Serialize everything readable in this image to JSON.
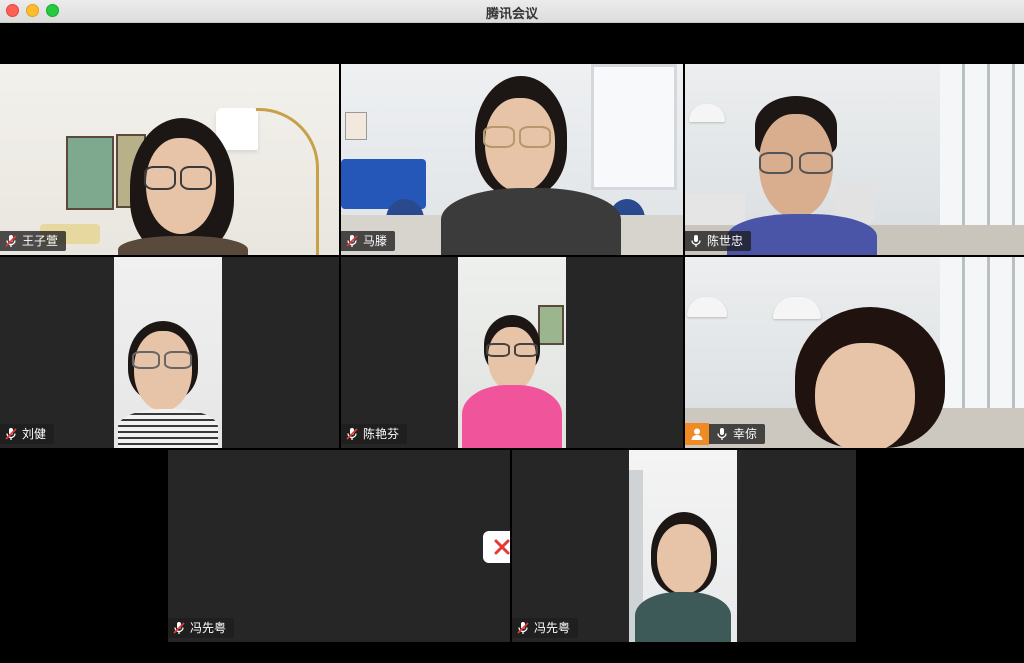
{
  "window": {
    "title": "腾讯会议"
  },
  "participants": [
    {
      "name": "王子萱",
      "mic": "muted"
    },
    {
      "name": "马滕",
      "mic": "muted"
    },
    {
      "name": "陈世忠",
      "mic": "on",
      "active_speaker": true
    },
    {
      "name": "刘健",
      "mic": "muted"
    },
    {
      "name": "陈艳芬",
      "mic": "muted"
    },
    {
      "name": "幸倞",
      "mic": "on",
      "avatar_icon": "person-icon"
    },
    {
      "name": "冯先粤",
      "mic": "muted",
      "camera": "off"
    },
    {
      "name": "冯先粤",
      "mic": "muted"
    }
  ],
  "colors": {
    "active_border": "#2ecc59",
    "muted_icon": "#e53935",
    "avatar_badge": "#f08a24",
    "camera_off_icon": "#e53935"
  }
}
